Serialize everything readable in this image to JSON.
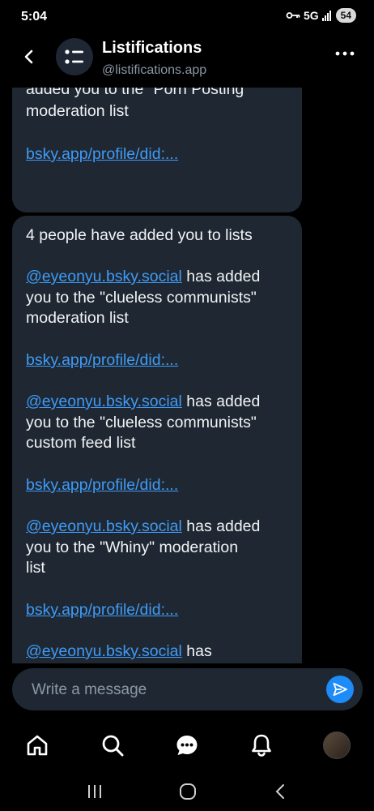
{
  "status": {
    "time": "5:04",
    "network": "5G",
    "battery": "54",
    "key_icon": "key-icon"
  },
  "header": {
    "title": "Listifications",
    "handle": "@listifications.app",
    "back_icon": "chevron-left-icon",
    "more_icon": "more-horizontal-icon",
    "avatar_icon": "list-icon"
  },
  "messages": [
    {
      "partial_top": "added you to the \"Porn Posting\"",
      "line2": "moderation list",
      "link": "bsky.app/profile/did:..."
    },
    {
      "intro": "4 people have added you to lists",
      "entries": [
        {
          "user": "@eyeonyu.bsky.social",
          "text_a": " has added",
          "text_b": "you to the \"clueless communists\"",
          "text_c": "moderation list",
          "link": "bsky.app/profile/did:..."
        },
        {
          "user": "@eyeonyu.bsky.social",
          "text_a": " has added",
          "text_b": "you to the \"clueless communists\"",
          "text_c": "custom feed list",
          "link": "bsky.app/profile/did:..."
        },
        {
          "user": "@eyeonyu.bsky.social",
          "text_a": " has added",
          "text_b": "you to the \"Whiny\" moderation",
          "text_c": "list",
          "link": "bsky.app/profile/did:..."
        },
        {
          "user": "@eyeonyu.bsky.social",
          "text_a": " has"
        }
      ]
    }
  ],
  "composer": {
    "placeholder": "Write a message",
    "send_icon": "send-icon"
  },
  "tabs": [
    {
      "name": "home",
      "icon": "home-icon"
    },
    {
      "name": "search",
      "icon": "search-icon"
    },
    {
      "name": "messages",
      "icon": "chat-icon"
    },
    {
      "name": "notifications",
      "icon": "bell-icon"
    },
    {
      "name": "profile",
      "icon": "avatar"
    }
  ],
  "system_nav": [
    "recents-icon",
    "home-circle-icon",
    "back-icon"
  ],
  "colors": {
    "bubble": "#1f2832",
    "link": "#3f9af6",
    "accent": "#1d8cf8",
    "background": "#000000"
  }
}
